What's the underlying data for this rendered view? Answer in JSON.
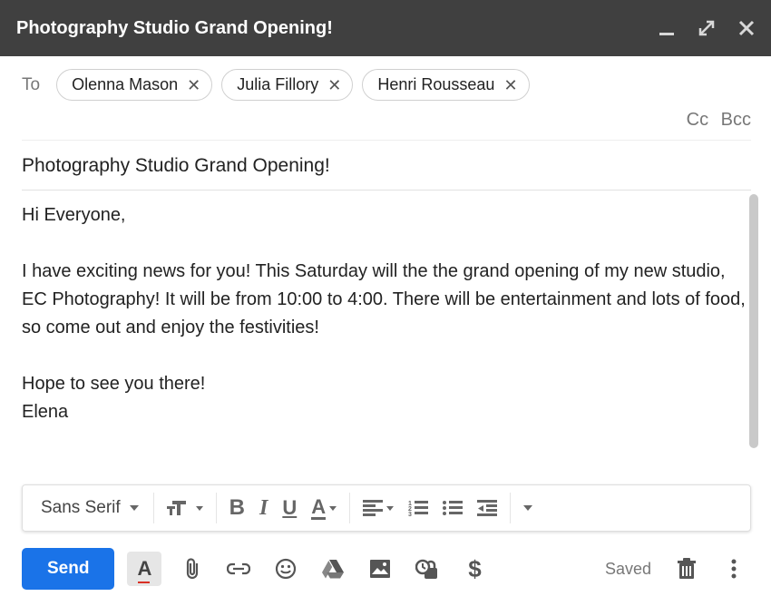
{
  "header": {
    "title": "Photography Studio Grand Opening!"
  },
  "to": {
    "label": "To",
    "recipients": [
      "Olenna Mason",
      "Julia Fillory",
      "Henri Rousseau"
    ],
    "cc_label": "Cc",
    "bcc_label": "Bcc"
  },
  "subject": "Photography Studio Grand Opening!",
  "body": {
    "greeting": "Hi Everyone,",
    "paragraph": "I have exciting news for you! This Saturday will the the grand opening of my new studio, EC Photography! It will be from 10:00 to 4:00. There will be entertainment and lots of food, so come out and enjoy the festivities!",
    "closing": "Hope to see you there!",
    "signature": "Elena"
  },
  "format_toolbar": {
    "font_family": "Sans Serif"
  },
  "actions": {
    "send_label": "Send",
    "saved_label": "Saved"
  },
  "icons": {
    "minimize": "minimize-icon",
    "maximize": "maximize-icon",
    "close_window": "close-icon",
    "chip_remove": "remove-icon",
    "font_size": "font-size-icon",
    "bold": "bold-icon",
    "italic": "italic-icon",
    "underline": "underline-icon",
    "text_color": "text-color-icon",
    "align": "align-icon",
    "numbered_list": "numbered-list-icon",
    "bulleted_list": "bulleted-list-icon",
    "indent_decrease": "indent-decrease-icon",
    "more_formatting": "more-formatting-icon",
    "formatting_options": "formatting-options-icon",
    "attach": "attachment-icon",
    "link": "link-icon",
    "emoji": "emoji-icon",
    "drive": "drive-icon",
    "photo": "photo-icon",
    "confidential": "confidential-icon",
    "money": "money-icon",
    "delete": "trash-icon",
    "more": "more-options-icon"
  }
}
